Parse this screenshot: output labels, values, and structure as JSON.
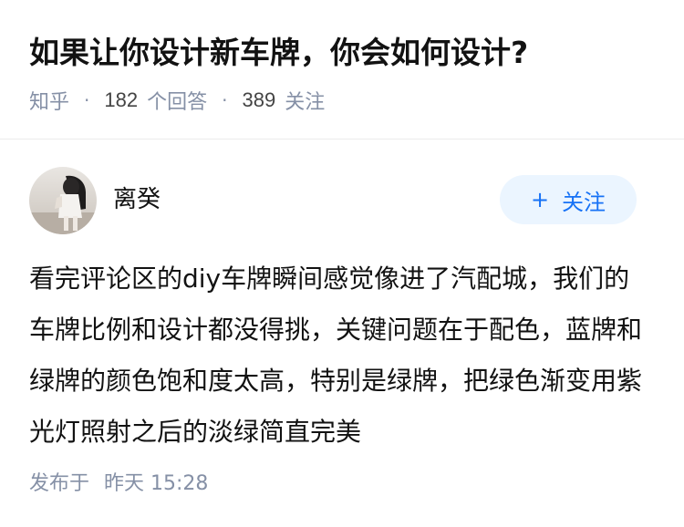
{
  "question": {
    "title": "如果让你设计新车牌，你会如何设计?",
    "source": "知乎",
    "answer_count": "182",
    "answer_label": "个回答",
    "follower_count": "389",
    "follower_label": "关注",
    "separator": "·"
  },
  "author": {
    "name": "离癸",
    "avatar_icon": "avatar-photo",
    "follow_button": {
      "icon": "plus-icon",
      "icon_glyph": "+",
      "label": "关注"
    }
  },
  "answer": {
    "content": "看完评论区的diy车牌瞬间感觉像进了汽配城，我们的车牌比例和设计都没得挑，关键问题在于配色，蓝牌和绿牌的颜色饱和度太高，特别是绿牌，把绿色渐变用紫光灯照射之后的淡绿简直完美",
    "published_label": "发布于",
    "published_time": "昨天 15:28"
  },
  "colors": {
    "title_text": "#121212",
    "meta_text": "#8590a6",
    "accent": "#1772f6",
    "follow_bg": "#ebf5ff",
    "divider": "#ebebeb"
  }
}
